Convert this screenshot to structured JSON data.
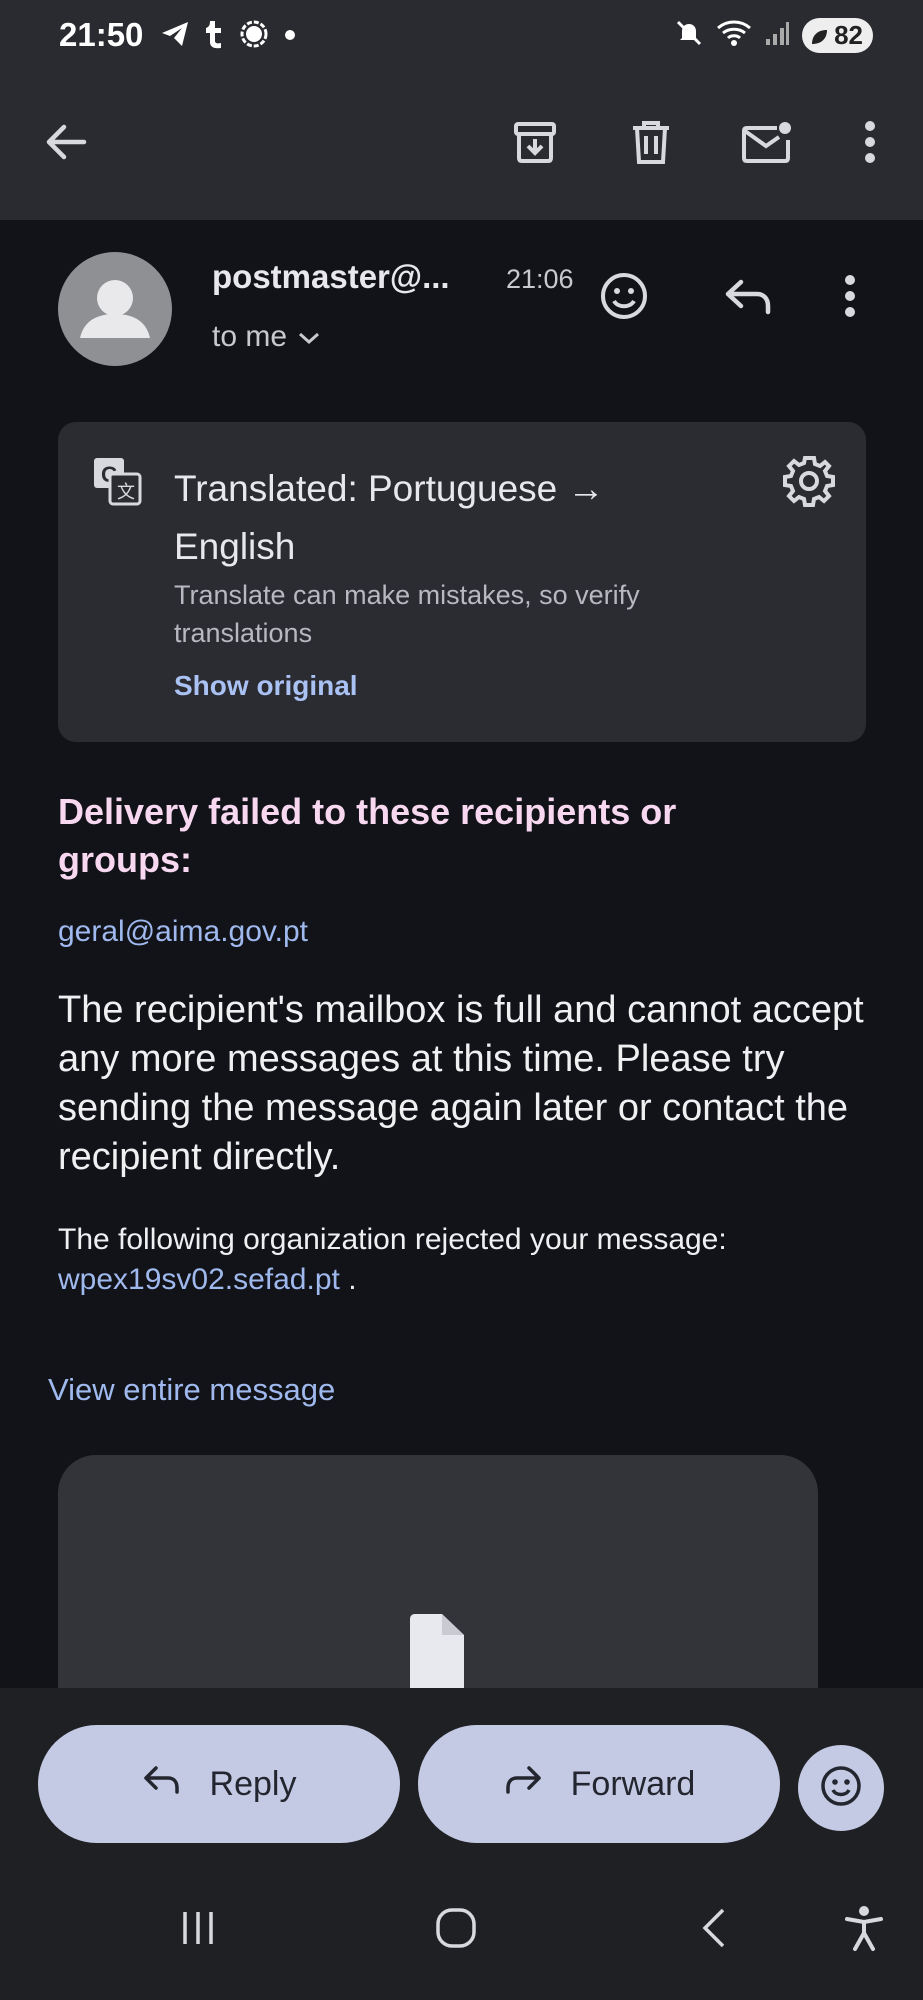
{
  "status_bar": {
    "time": "21:50",
    "left_icons": [
      "telegram-icon",
      "tumblr-icon",
      "signal-icon",
      "dot-icon"
    ],
    "right_icons": [
      "mute-icon",
      "wifi-icon",
      "signal-bars-icon"
    ],
    "battery": "82"
  },
  "toolbar": {
    "icons": [
      "back-arrow-icon",
      "archive-icon",
      "delete-icon",
      "mark-unread-icon",
      "more-vert-icon"
    ]
  },
  "header": {
    "sender": "postmaster@...",
    "time": "21:06",
    "recipient": "to me"
  },
  "translation": {
    "title": "Translated: Portuguese → English",
    "subtitle": "Translate can make mistakes, so verify translations",
    "show_original": "Show original"
  },
  "message": {
    "heading": "Delivery failed to these recipients or groups:",
    "recipient_email": "geral@aima.gov.pt",
    "body": "The recipient's mailbox is full and cannot accept any more messages at this time. Please try sending the message again later or contact the recipient directly.",
    "org_text": "The following organization rejected your message:",
    "org_link": "wpex19sv02.sefad.pt",
    "org_suffix": " .",
    "view_entire": "View entire message"
  },
  "actions": {
    "reply": "Reply",
    "forward": "Forward"
  },
  "colors": {
    "background": "#121318",
    "toolbar": "#2a2b30",
    "heading": "#f8d8f0",
    "link": "#9fb9ee",
    "pill": "#c4cae4"
  }
}
